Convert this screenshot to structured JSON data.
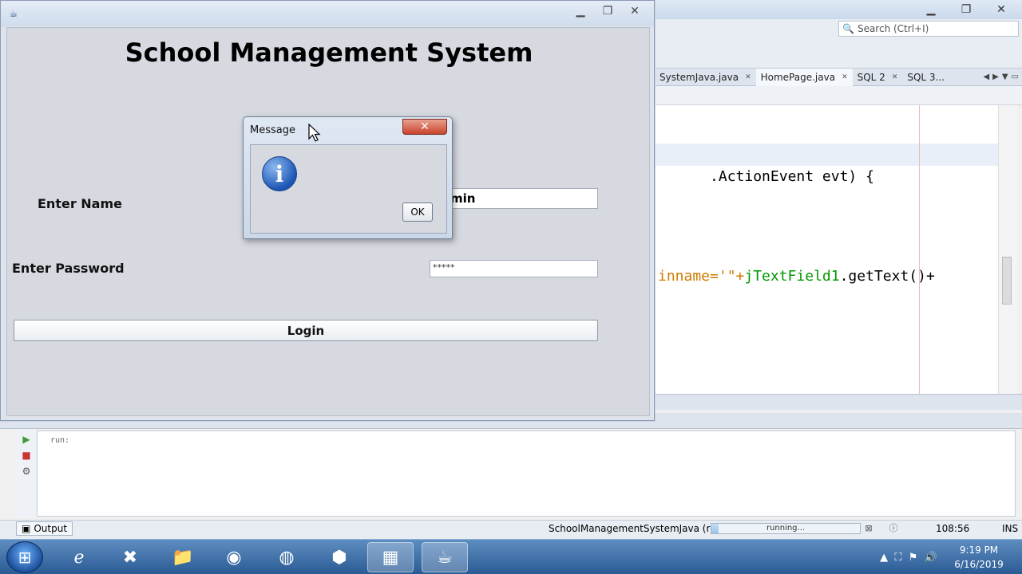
{
  "ide": {
    "search_placeholder": "Search (Ctrl+I)",
    "tabs": [
      {
        "label": "SystemJava.java",
        "active": false
      },
      {
        "label": "HomePage.java",
        "active": true
      },
      {
        "label": "SQL 2",
        "active": false
      },
      {
        "label": "SQL 3...",
        "active": false
      }
    ],
    "code": {
      "line1": ".ActionEvent evt) {",
      "line2_a": "inname='\"+",
      "line2_b": "jTextField1",
      "line2_c": ".getText()+"
    },
    "output": {
      "tab_label": "Output",
      "text": "run:"
    },
    "status": {
      "project": "SchoolManagementSystemJava (run)",
      "progress_label": "running...",
      "progress_fraction": 0.05,
      "position": "108:56",
      "mode": "INS"
    }
  },
  "app": {
    "heading": "School Management System",
    "name_label": "Enter Name",
    "name_value": "min",
    "password_label": "Enter Password",
    "password_value": "*****",
    "login_label": "Login"
  },
  "dialog": {
    "title": "Message",
    "close_glyph": "✕",
    "ok_label": "OK",
    "icon": "info-icon"
  },
  "taskbar": {
    "time": "9:19 PM",
    "date": "6/16/2019",
    "apps": [
      "internet-explorer-icon",
      "xampp-icon",
      "file-explorer-icon",
      "chrome-icon",
      "firefox-icon",
      "virtualbox-icon",
      "media-icon",
      "java-icon"
    ]
  },
  "colors": {
    "string_literal": "#ce7b00",
    "identifier": "#009900",
    "dialog_close": "#c8442c",
    "info_icon": "#1c56b4"
  }
}
